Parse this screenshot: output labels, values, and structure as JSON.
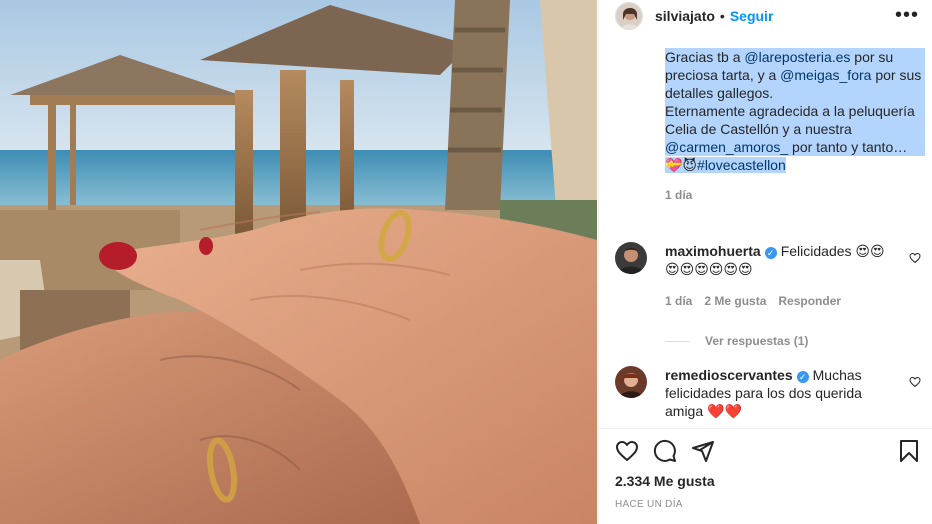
{
  "post": {
    "username": "silviajato",
    "separator": "•",
    "follow_label": "Seguir",
    "more_icon": "more-options-icon"
  },
  "caption": {
    "line1_pre": "Gracias tb a ",
    "mention1": "@lareposteria.es",
    "line1_post": " por su preciosa tarta, y a ",
    "mention2": "@meigas_fora",
    "line2_post": " por sus detalles gallegos.",
    "line3_pre": "Eternamente agradecida a la peluquería Celia de Castellón y a nuestra ",
    "mention3": "@carmen_amoros_",
    "line3_post": " por tanto y tanto…",
    "emoji": "💝😈",
    "hashtag": "#lovecastellon",
    "age": "1 día"
  },
  "comments": [
    {
      "username": "maximohuerta",
      "verified": true,
      "text": "Felicidades 😍😍 😍😍😍😍😍😍",
      "age": "1 día",
      "likes": "2 Me gusta",
      "reply_label": "Responder",
      "view_replies": "Ver respuestas (1)"
    },
    {
      "username": "remedioscervantes",
      "verified": true,
      "text": "Muchas felicidades para los dos querida amiga ❤️❤️"
    }
  ],
  "actions": {
    "like_icon": "heart-icon",
    "comment_icon": "comment-icon",
    "share_icon": "share-icon",
    "save_icon": "bookmark-icon",
    "likes_count": "2.334 Me gusta",
    "posted_time": "HACE UN DÍA"
  },
  "colors": {
    "follow_blue": "#0095f6",
    "mention_blue": "#00376b",
    "selection_highlight": "#b3d4fd",
    "verified_blue": "#3897f0",
    "muted_gray": "#8e8e8e"
  }
}
